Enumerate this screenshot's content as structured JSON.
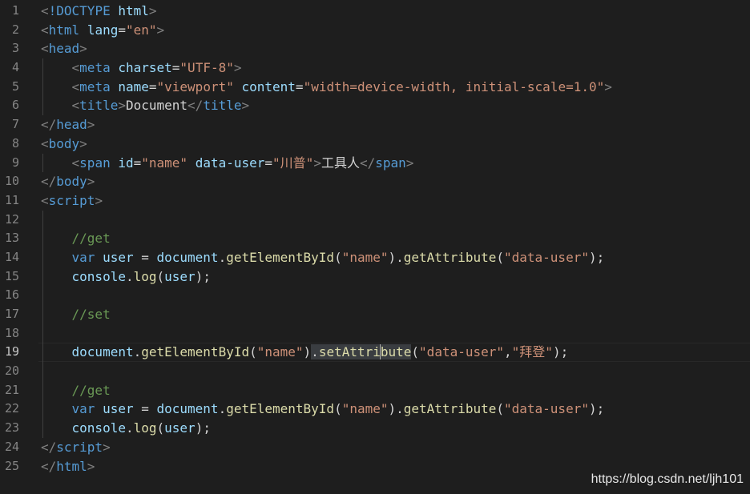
{
  "editor": {
    "theme_colors": {
      "background": "#1e1e1e",
      "line_number": "#858585",
      "tag": "#569cd6",
      "attribute": "#9cdcfe",
      "string": "#ce9178",
      "comment": "#6a9955",
      "function": "#dcdcaa",
      "punctuation": "#808080"
    },
    "current_line": 19,
    "lines": [
      {
        "n": "1",
        "tokens": [
          [
            "t-punct",
            "<"
          ],
          [
            "t-tag",
            "!DOCTYPE "
          ],
          [
            "t-attr",
            "html"
          ],
          [
            "t-punct",
            ">"
          ]
        ]
      },
      {
        "n": "2",
        "tokens": [
          [
            "t-punct",
            "<"
          ],
          [
            "t-tag",
            "html "
          ],
          [
            "t-attr",
            "lang"
          ],
          [
            "t-op",
            "="
          ],
          [
            "t-str",
            "\"en\""
          ],
          [
            "t-punct",
            ">"
          ]
        ]
      },
      {
        "n": "3",
        "tokens": [
          [
            "t-punct",
            "<"
          ],
          [
            "t-tag",
            "head"
          ],
          [
            "t-punct",
            ">"
          ]
        ]
      },
      {
        "n": "4",
        "guides": [
          1
        ],
        "tokens": [
          [
            "t-text",
            "    "
          ],
          [
            "t-punct",
            "<"
          ],
          [
            "t-tag",
            "meta "
          ],
          [
            "t-attr",
            "charset"
          ],
          [
            "t-op",
            "="
          ],
          [
            "t-str",
            "\"UTF-8\""
          ],
          [
            "t-punct",
            ">"
          ]
        ]
      },
      {
        "n": "5",
        "guides": [
          1
        ],
        "tokens": [
          [
            "t-text",
            "    "
          ],
          [
            "t-punct",
            "<"
          ],
          [
            "t-tag",
            "meta "
          ],
          [
            "t-attr",
            "name"
          ],
          [
            "t-op",
            "="
          ],
          [
            "t-str",
            "\"viewport\""
          ],
          [
            "t-text",
            " "
          ],
          [
            "t-attr",
            "content"
          ],
          [
            "t-op",
            "="
          ],
          [
            "t-str",
            "\"width=device-width, initial-scale=1.0\""
          ],
          [
            "t-punct",
            ">"
          ]
        ]
      },
      {
        "n": "6",
        "guides": [
          1
        ],
        "tokens": [
          [
            "t-text",
            "    "
          ],
          [
            "t-punct",
            "<"
          ],
          [
            "t-tag",
            "title"
          ],
          [
            "t-punct",
            ">"
          ],
          [
            "t-text",
            "Document"
          ],
          [
            "t-punct",
            "</"
          ],
          [
            "t-tag",
            "title"
          ],
          [
            "t-punct",
            ">"
          ]
        ]
      },
      {
        "n": "7",
        "tokens": [
          [
            "t-punct",
            "</"
          ],
          [
            "t-tag",
            "head"
          ],
          [
            "t-punct",
            ">"
          ]
        ]
      },
      {
        "n": "8",
        "tokens": [
          [
            "t-punct",
            "<"
          ],
          [
            "t-tag",
            "body"
          ],
          [
            "t-punct",
            ">"
          ]
        ]
      },
      {
        "n": "9",
        "guides": [
          1
        ],
        "tokens": [
          [
            "t-text",
            "    "
          ],
          [
            "t-punct",
            "<"
          ],
          [
            "t-tag",
            "span "
          ],
          [
            "t-attr",
            "id"
          ],
          [
            "t-op",
            "="
          ],
          [
            "t-str",
            "\"name\""
          ],
          [
            "t-text",
            " "
          ],
          [
            "t-attr",
            "data-user"
          ],
          [
            "t-op",
            "="
          ],
          [
            "t-str",
            "\"川普\""
          ],
          [
            "t-punct",
            ">"
          ],
          [
            "t-text",
            "工具人"
          ],
          [
            "t-punct",
            "</"
          ],
          [
            "t-tag",
            "span"
          ],
          [
            "t-punct",
            ">"
          ]
        ]
      },
      {
        "n": "10",
        "tokens": [
          [
            "t-punct",
            "</"
          ],
          [
            "t-tag",
            "body"
          ],
          [
            "t-punct",
            ">"
          ]
        ]
      },
      {
        "n": "11",
        "tokens": [
          [
            "t-punct",
            "<"
          ],
          [
            "t-tag",
            "script"
          ],
          [
            "t-punct",
            ">"
          ]
        ]
      },
      {
        "n": "12",
        "guides": [
          1
        ],
        "tokens": []
      },
      {
        "n": "13",
        "guides": [
          1
        ],
        "tokens": [
          [
            "t-text",
            "    "
          ],
          [
            "t-cmt",
            "//get"
          ]
        ]
      },
      {
        "n": "14",
        "guides": [
          1
        ],
        "tokens": [
          [
            "t-text",
            "    "
          ],
          [
            "t-kw",
            "var "
          ],
          [
            "t-var",
            "user"
          ],
          [
            "t-op",
            " = "
          ],
          [
            "t-var",
            "document"
          ],
          [
            "t-op",
            "."
          ],
          [
            "t-fn",
            "getElementById"
          ],
          [
            "t-op",
            "("
          ],
          [
            "t-str",
            "\"name\""
          ],
          [
            "t-op",
            ")."
          ],
          [
            "t-fn",
            "getAttribute"
          ],
          [
            "t-op",
            "("
          ],
          [
            "t-str",
            "\"data-user\""
          ],
          [
            "t-op",
            ");"
          ]
        ]
      },
      {
        "n": "15",
        "guides": [
          1
        ],
        "tokens": [
          [
            "t-text",
            "    "
          ],
          [
            "t-var",
            "console"
          ],
          [
            "t-op",
            "."
          ],
          [
            "t-fn",
            "log"
          ],
          [
            "t-op",
            "("
          ],
          [
            "t-var",
            "user"
          ],
          [
            "t-op",
            ");"
          ]
        ]
      },
      {
        "n": "16",
        "guides": [
          1
        ],
        "tokens": []
      },
      {
        "n": "17",
        "guides": [
          1
        ],
        "tokens": [
          [
            "t-text",
            "    "
          ],
          [
            "t-cmt",
            "//set"
          ]
        ]
      },
      {
        "n": "18",
        "guides": [
          1
        ],
        "tokens": []
      },
      {
        "n": "19",
        "guides": [
          1
        ],
        "tokens": [
          [
            "t-text",
            "    "
          ],
          [
            "t-var",
            "document"
          ],
          [
            "t-op",
            "."
          ],
          [
            "t-fn",
            "getElementById"
          ],
          [
            "t-op",
            "("
          ],
          [
            "t-str",
            "\"name\""
          ],
          [
            "t-op",
            ")"
          ],
          [
            "t-op t-sel",
            "."
          ],
          [
            "t-fn t-sel",
            "setAttri"
          ],
          [
            "cursor",
            ""
          ],
          [
            "t-fn t-sel",
            "bute"
          ],
          [
            "t-op",
            "("
          ],
          [
            "t-str",
            "\"data-user\""
          ],
          [
            "t-op",
            ","
          ],
          [
            "t-str",
            "\"拜登\""
          ],
          [
            "t-op",
            ");"
          ]
        ]
      },
      {
        "n": "20",
        "guides": [
          1
        ],
        "tokens": []
      },
      {
        "n": "21",
        "guides": [
          1
        ],
        "tokens": [
          [
            "t-text",
            "    "
          ],
          [
            "t-cmt",
            "//get"
          ]
        ]
      },
      {
        "n": "22",
        "guides": [
          1
        ],
        "tokens": [
          [
            "t-text",
            "    "
          ],
          [
            "t-kw",
            "var "
          ],
          [
            "t-var",
            "user"
          ],
          [
            "t-op",
            " = "
          ],
          [
            "t-var",
            "document"
          ],
          [
            "t-op",
            "."
          ],
          [
            "t-fn",
            "getElementById"
          ],
          [
            "t-op",
            "("
          ],
          [
            "t-str",
            "\"name\""
          ],
          [
            "t-op",
            ")."
          ],
          [
            "t-fn",
            "getAttribute"
          ],
          [
            "t-op",
            "("
          ],
          [
            "t-str",
            "\"data-user\""
          ],
          [
            "t-op",
            ");"
          ]
        ]
      },
      {
        "n": "23",
        "guides": [
          1
        ],
        "tokens": [
          [
            "t-text",
            "    "
          ],
          [
            "t-var",
            "console"
          ],
          [
            "t-op",
            "."
          ],
          [
            "t-fn",
            "log"
          ],
          [
            "t-op",
            "("
          ],
          [
            "t-var",
            "user"
          ],
          [
            "t-op",
            ");"
          ]
        ]
      },
      {
        "n": "24",
        "tokens": [
          [
            "t-punct",
            "</"
          ],
          [
            "t-tag",
            "script"
          ],
          [
            "t-punct",
            ">"
          ]
        ]
      },
      {
        "n": "25",
        "tokens": [
          [
            "t-punct",
            "</"
          ],
          [
            "t-tag",
            "html"
          ],
          [
            "t-punct",
            ">"
          ]
        ]
      }
    ]
  },
  "watermark": {
    "text": "https://blog.csdn.net/ljh101"
  }
}
